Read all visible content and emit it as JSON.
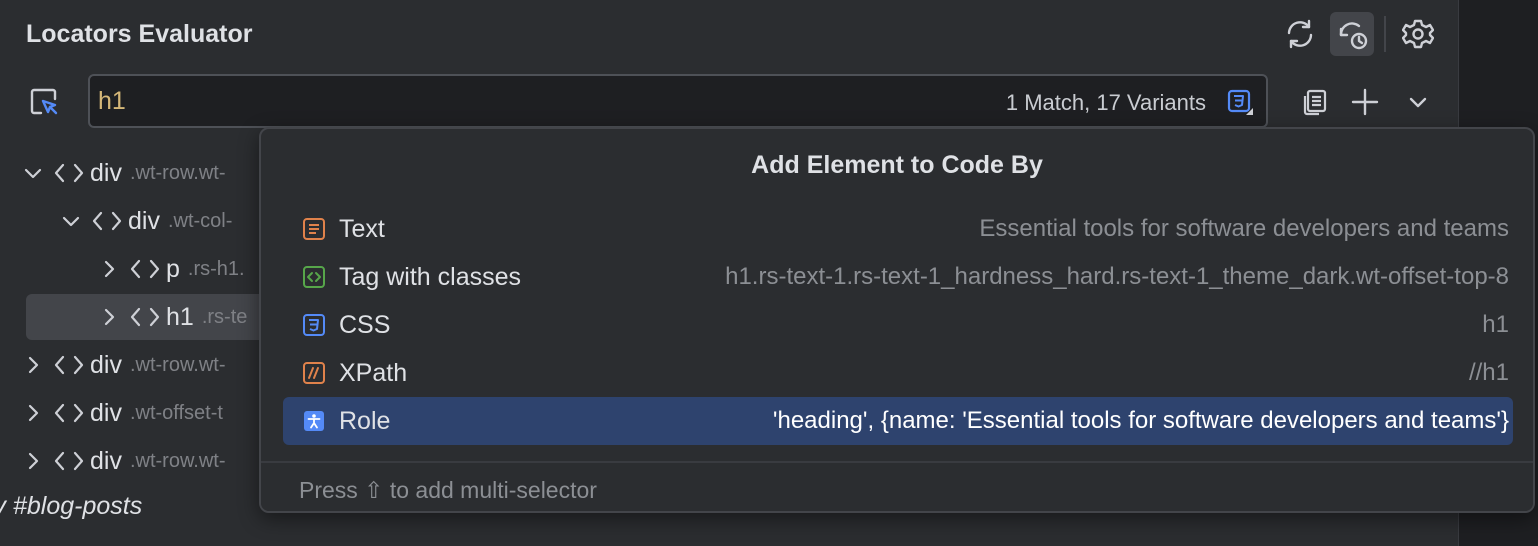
{
  "header": {
    "title": "Locators Evaluator"
  },
  "toolbar": {
    "icons": [
      "refresh-icon",
      "refresh-history-icon",
      "settings-icon"
    ]
  },
  "search": {
    "value": "h1",
    "status": "1 Match, 17 Variants",
    "type_icon": "css-icon"
  },
  "actions": {
    "icons": [
      "copy-icon",
      "plus-icon",
      "chevron-down-icon"
    ]
  },
  "tree": {
    "rows": [
      {
        "tag": "div",
        "classes": ".wt-row.wt-",
        "expanded": true,
        "level": 0
      },
      {
        "tag": "div",
        "classes": ".wt-col-",
        "expanded": true,
        "level": 1
      },
      {
        "tag": "p",
        "classes": ".rs-h1.",
        "expanded": false,
        "level": 2
      },
      {
        "tag": "h1",
        "classes": ".rs-te",
        "expanded": false,
        "level": 2,
        "selected": true
      },
      {
        "tag": "div",
        "classes": ".wt-row.wt-",
        "expanded": false,
        "level": 0
      },
      {
        "tag": "div",
        "classes": ".wt-offset-t",
        "expanded": false,
        "level": 0
      },
      {
        "tag": "div",
        "classes": ".wt-row.wt-",
        "expanded": false,
        "level": 0
      }
    ],
    "blog_label": "iv #blog-posts"
  },
  "popup": {
    "title": "Add Element to Code By",
    "options": [
      {
        "label": "Text",
        "value": "Essential tools for software developers and teams",
        "icon": "text-icon",
        "color": "#e0824b"
      },
      {
        "label": "Tag with classes",
        "value": "h1.rs-text-1.rs-text-1_hardness_hard.rs-text-1_theme_dark.wt-offset-top-8",
        "icon": "tag-icon",
        "color": "#57a64a"
      },
      {
        "label": "CSS",
        "value": "h1",
        "icon": "css-icon",
        "color": "#548af7"
      },
      {
        "label": "XPath",
        "value": "//h1",
        "icon": "xpath-icon",
        "color": "#e0824b"
      },
      {
        "label": "Role",
        "value": "'heading', {name: 'Essential tools for software developers and teams'}",
        "icon": "accessibility-icon",
        "color": "#548af7",
        "selected": true
      }
    ],
    "footer": "Press ⇧ to add multi-selector"
  },
  "colors": {
    "accent": "#548af7",
    "selection": "#2e436e",
    "background": "#2b2d30",
    "search_text": "#d5b778"
  }
}
